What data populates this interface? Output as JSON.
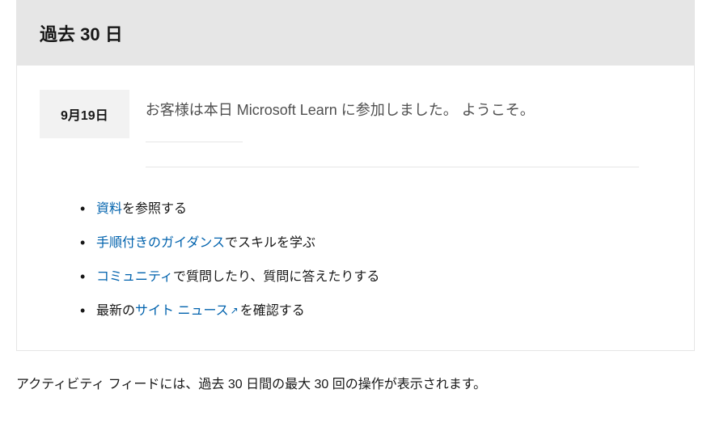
{
  "header": {
    "title": "過去 30 日"
  },
  "entry": {
    "date": "9月19日",
    "welcome": "お客様は本日 Microsoft Learn に参加しました。 ようこそ。"
  },
  "links": {
    "items": [
      {
        "link": "資料",
        "$sep": "",
        "suffix": "を参照する",
        "external": false
      },
      {
        "link": "手順付きのガイダンス",
        "$sep": "",
        "suffix": "でスキルを学ぶ",
        "external": false
      },
      {
        "link": "コミュニティ",
        "$sep": "",
        "suffix": "で質問したり、質問に答えたりする",
        "external": false
      },
      {
        "prefix": "最新の",
        "link": "サイト ニュース",
        "$sep": "",
        "suffix": "を確認する",
        "external": true
      }
    ]
  },
  "footer": {
    "text": "アクティビティ フィードには、過去 30 日間の最大 30 回の操作が表示されます。"
  }
}
